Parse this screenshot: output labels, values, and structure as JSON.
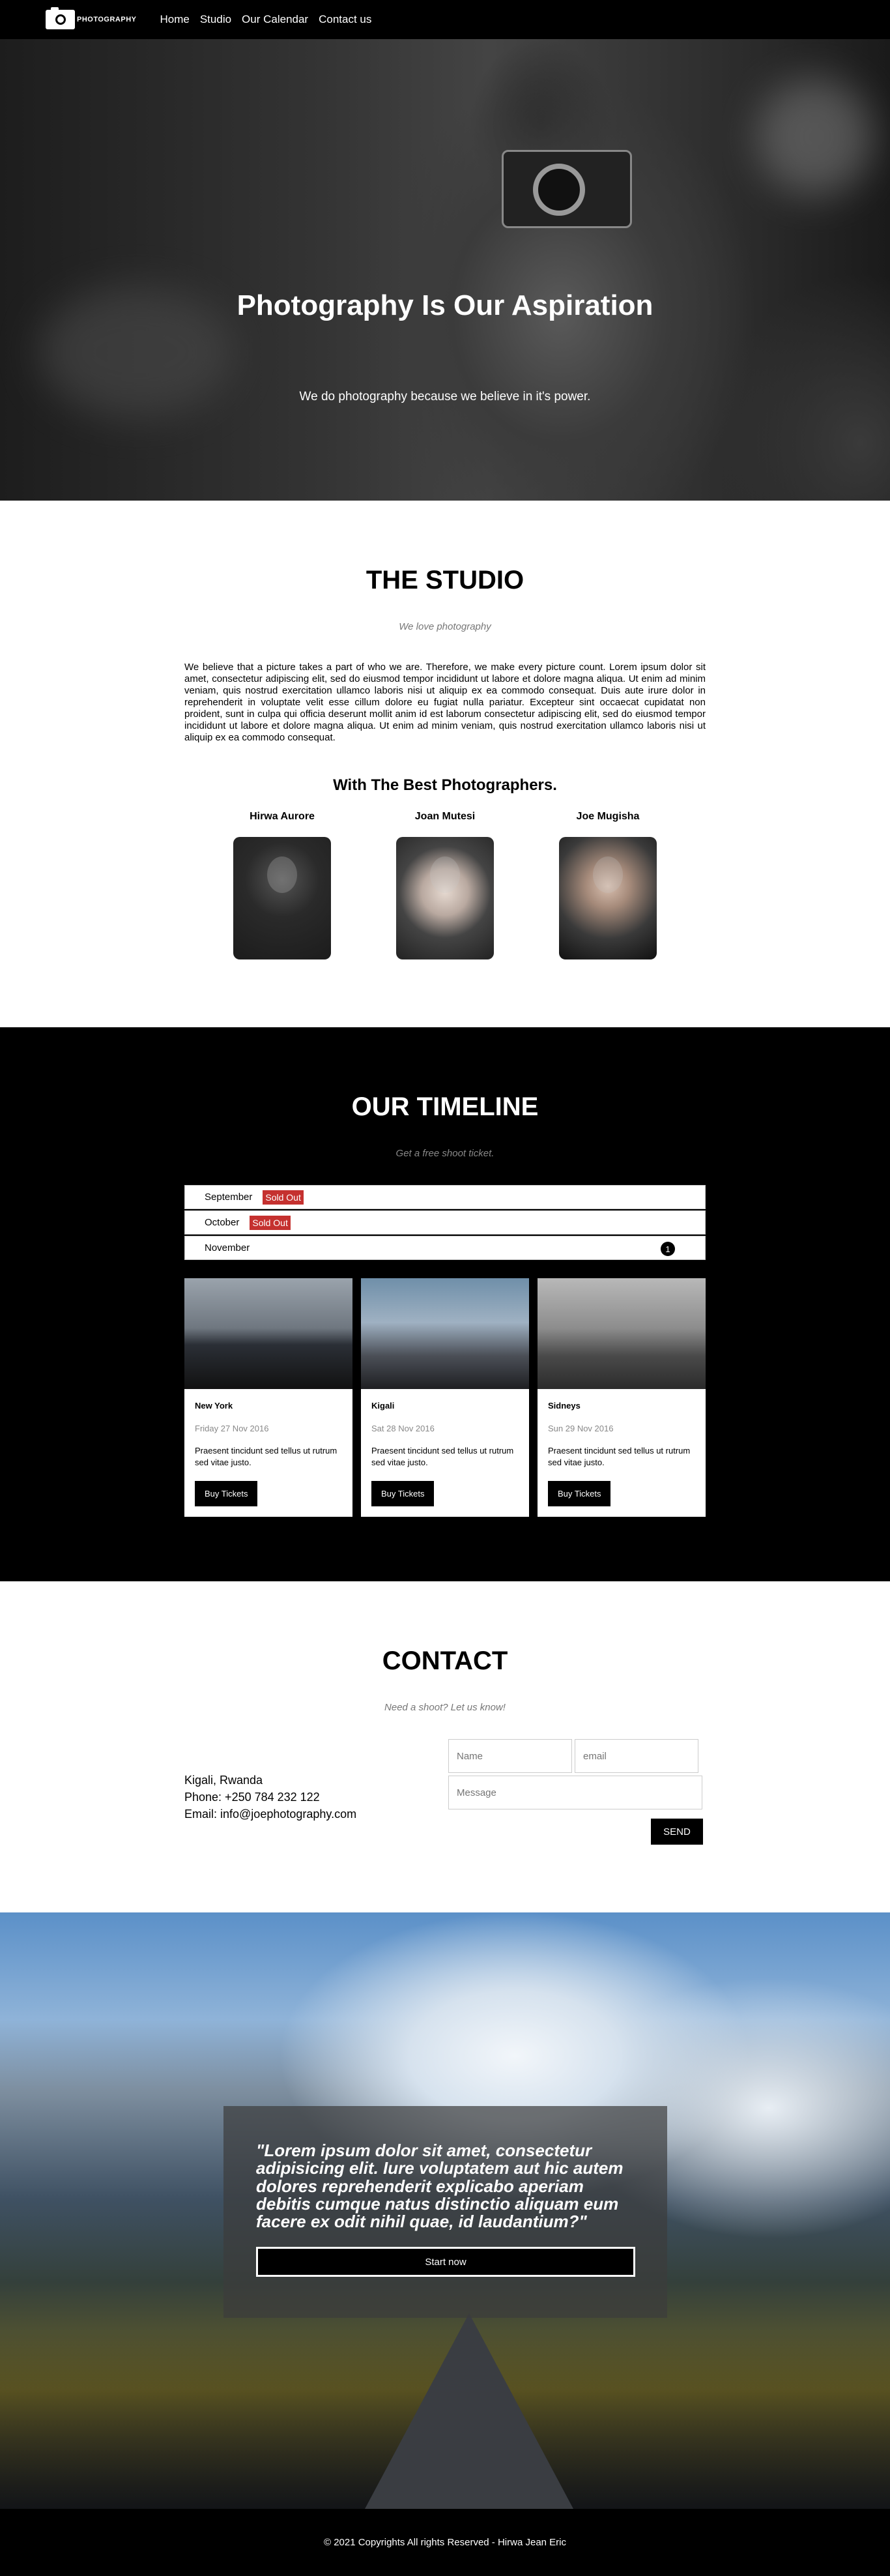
{
  "nav": {
    "logo_text": "PHOTOGRAPHY",
    "links": [
      "Home",
      "Studio",
      "Our Calendar",
      "Contact us"
    ]
  },
  "hero": {
    "title": "Photography Is Our Aspiration",
    "subtitle": "We do photography because we believe in it's power."
  },
  "studio": {
    "title": "THE STUDIO",
    "subtitle": "We love photography",
    "body": "We believe that a picture takes a part of who we are. Therefore, we make every picture count. Lorem ipsum dolor sit amet, consectetur adipiscing elit, sed do eiusmod tempor incididunt ut labore et dolore magna aliqua. Ut enim ad minim veniam, quis nostrud exercitation ullamco laboris nisi ut aliquip ex ea commodo consequat. Duis aute irure dolor in reprehenderit in voluptate velit esse cillum dolore eu fugiat nulla pariatur. Excepteur sint occaecat cupidatat non proident, sunt in culpa qui officia deserunt mollit anim id est laborum consectetur adipiscing elit, sed do eiusmod tempor incididunt ut labore et dolore magna aliqua. Ut enim ad minim veniam, quis nostrud exercitation ullamco laboris nisi ut aliquip ex ea commodo consequat.",
    "team_heading": "With The Best Photographers.",
    "team": [
      {
        "name": "Hirwa Aurore"
      },
      {
        "name": "Joan Mutesi"
      },
      {
        "name": "Joe Mugisha"
      }
    ]
  },
  "timeline": {
    "title": "OUR TIMELINE",
    "subtitle": "Get a free shoot ticket.",
    "months": [
      {
        "label": "September",
        "status": "Sold Out"
      },
      {
        "label": "October",
        "status": "Sold Out"
      },
      {
        "label": "November",
        "count": "1"
      }
    ],
    "cards": [
      {
        "city": "New York",
        "date": "Friday 27 Nov 2016",
        "desc": "Praesent tincidunt sed tellus ut rutrum sed vitae justo.",
        "button": "Buy Tickets"
      },
      {
        "city": "Kigali",
        "date": "Sat 28 Nov 2016",
        "desc": "Praesent tincidunt sed tellus ut rutrum sed vitae justo.",
        "button": "Buy Tickets"
      },
      {
        "city": "Sidneys",
        "date": "Sun 29 Nov 2016",
        "desc": "Praesent tincidunt sed tellus ut rutrum sed vitae justo.",
        "button": "Buy Tickets"
      }
    ]
  },
  "contact": {
    "title": "CONTACT",
    "subtitle": "Need a shoot? Let us know!",
    "location": "Kigali, Rwanda",
    "phone": "Phone: +250 784 232 122",
    "email": "Email: info@joephotography.com",
    "form": {
      "name_placeholder": "Name",
      "email_placeholder": "email",
      "message_placeholder": "Message",
      "send_label": "SEND"
    }
  },
  "banner": {
    "quote": "\"Lorem ipsum dolor sit amet, consectetur adipisicing elit. Iure voluptatem aut hic autem dolores reprehenderit explicabo aperiam debitis cumque natus distinctio aliquam eum facere ex odit nihil quae, id laudantium?\"",
    "button": "Start now"
  },
  "footer": {
    "text": "© 2021 Copyrights All rights Reserved - Hirwa Jean Eric"
  }
}
